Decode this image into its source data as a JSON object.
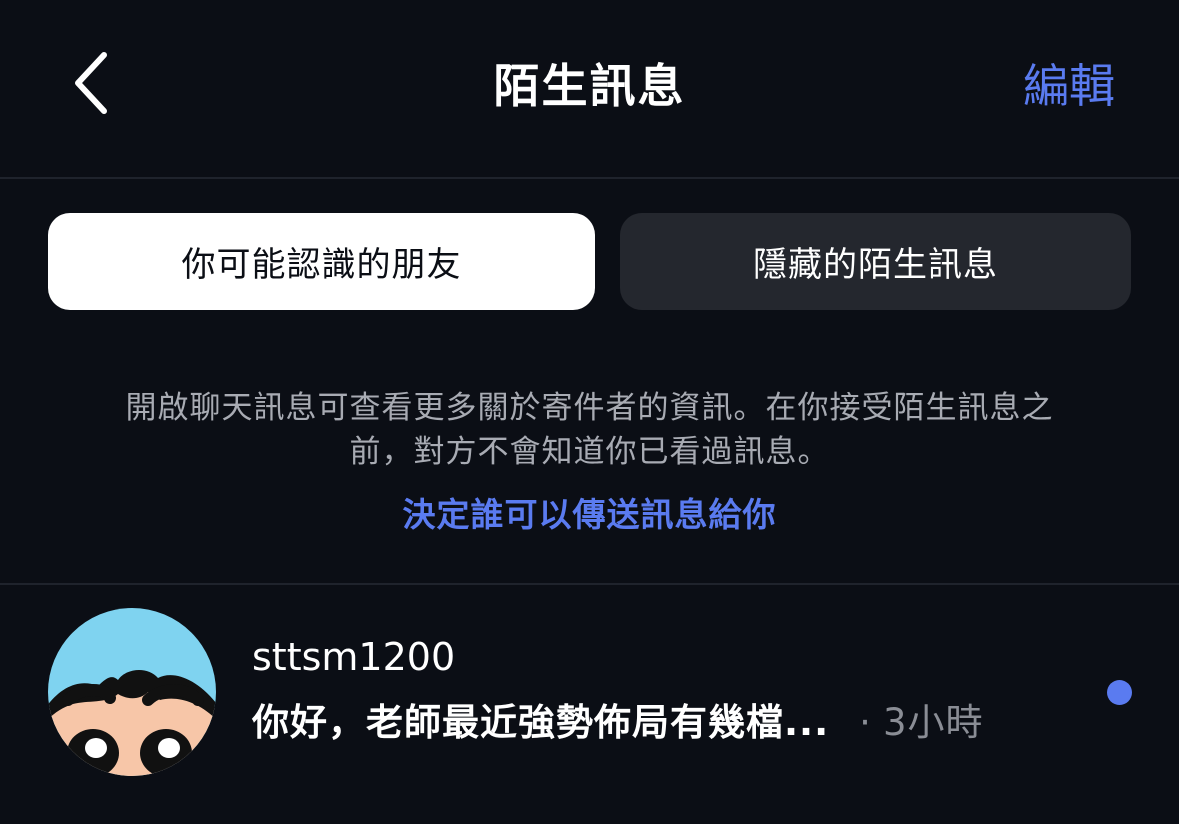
{
  "header": {
    "title": "陌生訊息",
    "edit_label": "編輯"
  },
  "tabs": [
    {
      "label": "你可能認識的朋友",
      "active": true
    },
    {
      "label": "隱藏的陌生訊息",
      "active": false
    }
  ],
  "info": {
    "line1": "開啟聊天訊息可查看更多關於寄件者的資訊。在你接受陌生訊息之",
    "line2": "前，對方不會知道你已看過訊息。",
    "link_label": "決定誰可以傳送訊息給你"
  },
  "messages": [
    {
      "username": "sttsm1200",
      "preview": "你好，老師最近強勢佈局有幾檔...",
      "separator": "·",
      "time": "3小時",
      "unread": true
    }
  ],
  "colors": {
    "background": "#0b0e15",
    "accent": "#5a7bf0",
    "secondary_text": "#a8abb3",
    "inactive_tab": "#24272e"
  },
  "icons": {
    "back": "chevron-left-icon",
    "unread": "unread-dot-icon"
  }
}
